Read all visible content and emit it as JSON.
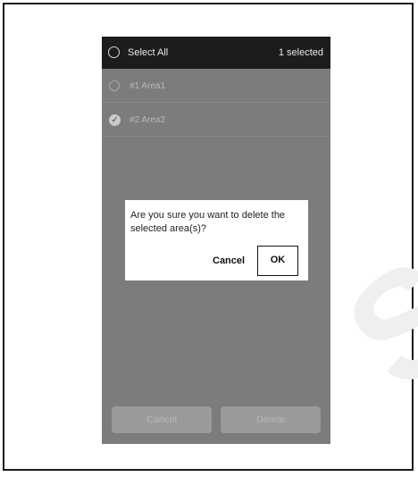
{
  "header": {
    "select_all_label": "Select All",
    "selected_count": "1 selected"
  },
  "areas": [
    {
      "label": "#1 Area1",
      "selected": false
    },
    {
      "label": "#2 Area2",
      "selected": true
    }
  ],
  "footer": {
    "cancel_label": "Cancel",
    "delete_label": "Delete"
  },
  "dialog": {
    "message": "Are you sure you want to delete the selected area(s)?",
    "cancel_label": "Cancel",
    "ok_label": "OK"
  },
  "watermark": "SP",
  "colors": {
    "topbar": "#1c1c1c",
    "overlay": "#7c7c7c",
    "dialog": "#ffffff"
  }
}
